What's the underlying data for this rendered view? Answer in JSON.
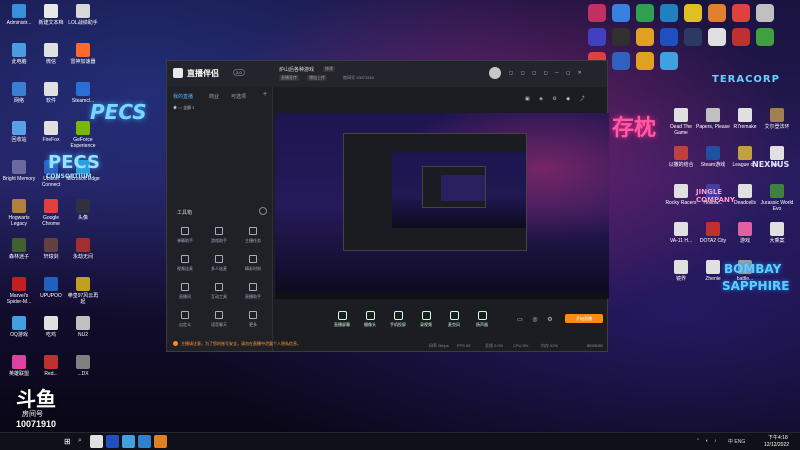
{
  "desktop": {
    "left_icons": [
      {
        "label": "Administr...",
        "color": "#3a8fd9"
      },
      {
        "label": "新建文本档",
        "color": "#e8e8e8"
      },
      {
        "label": "LOL战绩助手",
        "color": "#d8d8d8"
      },
      {
        "label": "此电脑",
        "color": "#4a9be0"
      },
      {
        "label": "微信",
        "color": "#e0e0e0"
      },
      {
        "label": "雷神加速器",
        "color": "#ff6a2a"
      },
      {
        "label": "网络",
        "color": "#3c7fd0"
      },
      {
        "label": "软件",
        "color": "#e0e0e0"
      },
      {
        "label": "Steamcl...",
        "color": "#2b6fd6"
      },
      {
        "label": "回收站",
        "color": "#5aa0e8"
      },
      {
        "label": "FireFox",
        "color": "#e0e0e0"
      },
      {
        "label": "GeForce Experience",
        "color": "#77b900"
      },
      {
        "label": "Bright Memory",
        "color": "#6a6aa0"
      },
      {
        "label": "Ubisoft Connect",
        "color": "#2a60c0"
      },
      {
        "label": "Microsoft Edge",
        "color": "#2a9fd8"
      },
      {
        "label": "Hogwarts Legacy",
        "color": "#b08040"
      },
      {
        "label": "Google Chrome",
        "color": "#e04040"
      },
      {
        "label": "头像",
        "color": "#303040"
      },
      {
        "label": "森林迷子",
        "color": "#406030"
      },
      {
        "label": "轩辕剑",
        "color": "#604040"
      },
      {
        "label": "永劫无间",
        "color": "#a03030"
      },
      {
        "label": "Marvel's Spider-M...",
        "color": "#c02020"
      },
      {
        "label": "UPUPOO",
        "color": "#2060c0"
      },
      {
        "label": "拳皇97风云再起",
        "color": "#c0a020"
      },
      {
        "label": "OQ游戏",
        "color": "#40a0e0"
      },
      {
        "label": "吃鸡",
        "color": "#e0e0e0"
      },
      {
        "label": "NU2",
        "color": "#c0c0c0"
      },
      {
        "label": "英雄联盟",
        "color": "#e040a0"
      },
      {
        "label": "Red...",
        "color": "#c03030"
      },
      {
        "label": "...DX",
        "color": "#808080"
      }
    ],
    "right_icons": [
      {
        "label": "Dead The Game",
        "color": "#e0e0e0"
      },
      {
        "label": "Papers, Please",
        "color": "#c0c0c0"
      },
      {
        "label": "R7remake",
        "color": "#e0e0e0"
      },
      {
        "label": "艾尔登法环",
        "color": "#a08050"
      },
      {
        "label": "以撒的结合",
        "color": "#c04040"
      },
      {
        "label": "Steam游戏",
        "color": "#2050a0"
      },
      {
        "label": "League o...",
        "color": "#c0a040"
      },
      {
        "label": "spi...",
        "color": "#e0e0e0"
      },
      {
        "label": "Rocky Racers",
        "color": "#e0e0e0"
      },
      {
        "label": "Hollow...",
        "color": "#4040a0"
      },
      {
        "label": "Deadcells",
        "color": "#e0e0e0"
      },
      {
        "label": "Jurassic World Evo",
        "color": "#408040"
      },
      {
        "label": "VA-11 H...",
        "color": "#e0e0e0"
      },
      {
        "label": "DOTA2 City",
        "color": "#c03030"
      },
      {
        "label": "游戏",
        "color": "#e060a0"
      },
      {
        "label": "大乘案",
        "color": "#e0e0e0"
      },
      {
        "label": "镜界",
        "color": "#e0e0e0"
      },
      {
        "label": "Zhenle",
        "color": "#e0e0e0"
      },
      {
        "label": "battle...",
        "color": "#a0a0a0"
      }
    ],
    "tray_icon_colors": [
      "#c03060",
      "#3a80e0",
      "#30a050",
      "#2080c0",
      "#e0c020",
      "#e08030",
      "#e04040",
      "#c0c0c0",
      "#4040c0",
      "#303030",
      "#e0a020",
      "#2050c0",
      "#2a3a60",
      "#e0e0e0",
      "#c03030",
      "#40a040",
      "#e04040",
      "#3060c0",
      "#e0a020",
      "#40a0e0"
    ],
    "neon_text": {
      "top_left": "PECS",
      "mid_left": "PECS",
      "mid_left_sub": "CONSORTIUM",
      "corp": "TERACORP",
      "nexus": "NEXNUS",
      "company": "JINGLE COMPANY",
      "bombay": "BOMBAY",
      "sapphire": "SAPPHIRE",
      "chinese": "存枕"
    }
  },
  "obs_window": {
    "app_title": "直播伴侣",
    "app_badge": "2.0",
    "channel": "炉山后各种游戏",
    "edit_label": "修改",
    "tabs": [
      "我的直播",
      "商业",
      "可选项"
    ],
    "scene_label": "全屏 1",
    "stream_tags": [
      "直播宣传",
      "增加上传"
    ],
    "room_label": "房间号 10071910",
    "tools_header": "工具箱",
    "tools": [
      "弹幕助手",
      "游戏助手",
      "主播任务",
      "视频连麦",
      "多人连麦",
      "精彩时刻",
      "直播间",
      "互动工具",
      "直播助手",
      "自定义",
      "语音聊天",
      "更多"
    ],
    "bottom_tools": [
      "直播屏幕",
      "摄像头",
      "手机投屏",
      "录视频",
      "麦克风",
      "扬声器"
    ],
    "start_button": "开始直播",
    "notice": "主播请注意，为了您的账号安全，请勿在直播中泄露个人隐私信息。",
    "status": [
      "码率 0kbps",
      "FPS 60",
      "丢帧 0.0%",
      "CPU 8%",
      "内存 52%"
    ],
    "timer": "00:00:00"
  },
  "watermark": {
    "logo_text": "斗鱼",
    "room_label": "房间号",
    "room_number": "10071910"
  },
  "taskbar": {
    "app_colors": [
      "#e0e0e0",
      "#2050c0",
      "#40a0e0",
      "#3080d0",
      "#e08020"
    ],
    "tray_text": "中  ENG",
    "time": "下午4:18",
    "date": "12/12/2022"
  }
}
